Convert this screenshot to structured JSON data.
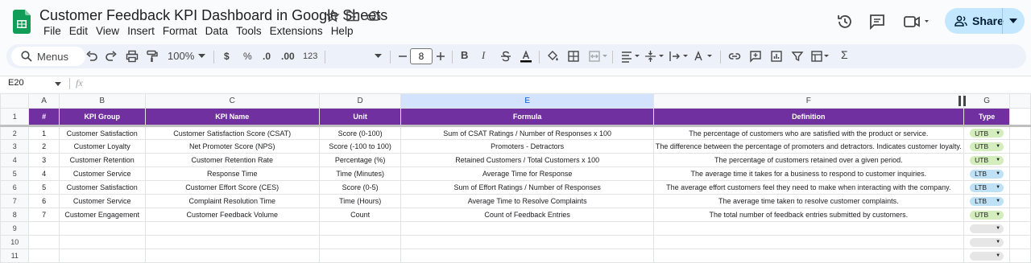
{
  "app": {
    "title": "Customer Feedback KPI Dashboard in Google Sheets",
    "menu": [
      "File",
      "Edit",
      "View",
      "Insert",
      "Format",
      "Data",
      "Tools",
      "Extensions",
      "Help"
    ],
    "share_label": "Share"
  },
  "toolbar": {
    "menus_label": "Menus",
    "zoom": "100%",
    "currency": "$",
    "percent": "%",
    "dec_decrease": ".0",
    "dec_increase": ".00",
    "format_123": "123",
    "font_size": "8"
  },
  "formula_bar": {
    "cell_ref": "E20",
    "fx": "fx"
  },
  "columns": [
    "A",
    "B",
    "C",
    "D",
    "E",
    "F",
    "G"
  ],
  "headers": [
    "#",
    "KPI Group",
    "KPI Name",
    "Unit",
    "Formula",
    "Definition",
    "Type"
  ],
  "rows": [
    {
      "num": "1",
      "group": "Customer Satisfaction",
      "name": "Customer Satisfaction Score (CSAT)",
      "unit": "Score (0-100)",
      "formula": "Sum of CSAT Ratings / Number of Responses x 100",
      "definition": "The percentage of customers who are satisfied with the product or service.",
      "type": "UTB"
    },
    {
      "num": "2",
      "group": "Customer Loyalty",
      "name": "Net Promoter Score (NPS)",
      "unit": "Score (-100 to 100)",
      "formula": "Promoters - Detractors",
      "definition": "The difference between the percentage of promoters and detractors. Indicates customer loyalty.",
      "type": "UTB"
    },
    {
      "num": "3",
      "group": "Customer Retention",
      "name": "Customer Retention Rate",
      "unit": "Percentage (%)",
      "formula": "Retained Customers / Total Customers x 100",
      "definition": "The percentage of customers retained over a given period.",
      "type": "UTB"
    },
    {
      "num": "4",
      "group": "Customer Service",
      "name": "Response Time",
      "unit": "Time (Minutes)",
      "formula": "Average Time for Response",
      "definition": "The average time it takes for a business to respond to customer inquiries.",
      "type": "LTB"
    },
    {
      "num": "5",
      "group": "Customer Satisfaction",
      "name": "Customer Effort Score (CES)",
      "unit": "Score (0-5)",
      "formula": "Sum of Effort Ratings / Number of Responses",
      "definition": "The average effort customers feel they need to make when interacting with the company.",
      "type": "LTB"
    },
    {
      "num": "6",
      "group": "Customer Service",
      "name": "Complaint Resolution Time",
      "unit": "Time (Hours)",
      "formula": "Average Time to Resolve Complaints",
      "definition": "The average time taken to resolve customer complaints.",
      "type": "LTB"
    },
    {
      "num": "7",
      "group": "Customer Engagement",
      "name": "Customer Feedback Volume",
      "unit": "Count",
      "formula": "Count of Feedback Entries",
      "definition": "The total number of feedback entries submitted by customers.",
      "type": "UTB"
    }
  ],
  "row_numbers": [
    "1",
    "2",
    "3",
    "4",
    "5",
    "6",
    "7",
    "8",
    "9",
    "10",
    "11"
  ],
  "colors": {
    "header_bg": "#7030a0",
    "utb_chip": "#d4edbc",
    "ltb_chip": "#bfe1f6",
    "empty_chip": "#e6e6e6"
  }
}
